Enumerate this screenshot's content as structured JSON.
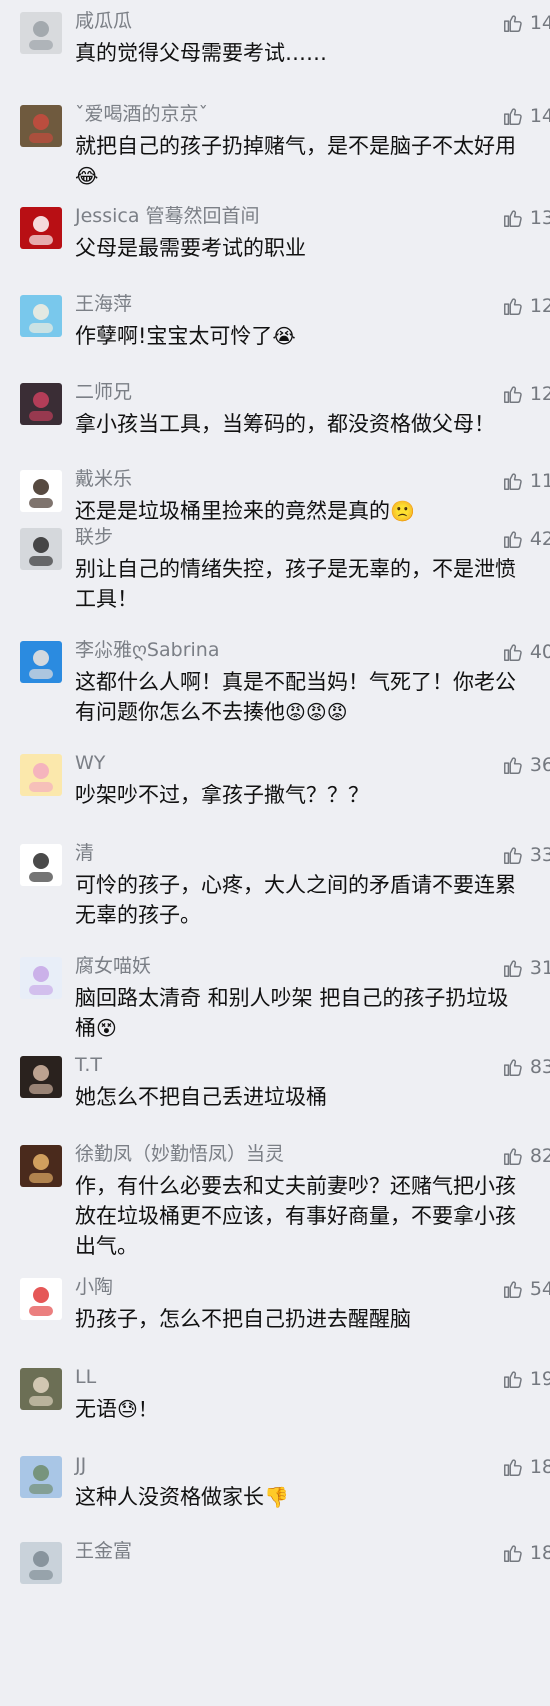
{
  "comments": [
    {
      "name": "咸瓜瓜",
      "likes": "14",
      "text": "真的觉得父母需要考试……",
      "emoji": "",
      "avatar": {
        "bg": "#d8dadd",
        "fg": "#9aa0a6"
      }
    },
    {
      "name": "ˇ爱喝酒的京京ˇ",
      "likes": "14",
      "text": "就把自己的孩子扔掉赌气，是不是脑子不太好用",
      "emoji": "😂",
      "avatar": {
        "bg": "#6f5a3e",
        "fg": "#c94b3e"
      }
    },
    {
      "name": "Jessica 管蓦然回首间",
      "likes": "13",
      "text": "父母是最需要考试的职业",
      "emoji": "",
      "avatar": {
        "bg": "#b80f14",
        "fg": "#ffffff"
      }
    },
    {
      "name": "王海萍",
      "likes": "12",
      "text": "作孽啊!宝宝太可怜了",
      "emoji": "😭",
      "avatar": {
        "bg": "#79c8ec",
        "fg": "#f6efe0"
      }
    },
    {
      "name": "二师兄",
      "likes": "12",
      "text": "拿小孩当工具，当筹码的，都没资格做父母！",
      "emoji": "",
      "avatar": {
        "bg": "#3a2d35",
        "fg": "#c9415e"
      }
    },
    {
      "name": "戴米乐",
      "likes": "11",
      "text": "还是是垃圾桶里捡来的竟然是真的",
      "emoji": "🙁",
      "avatar": {
        "bg": "#ffffff",
        "fg": "#3a2a20"
      }
    },
    {
      "name": "联步",
      "likes": "42",
      "text": "别让自己的情绪失控，孩子是无辜的，不是泄愤工具！",
      "emoji": "",
      "avatar": {
        "bg": "#d5d8dc",
        "fg": "#2b2b2b"
      }
    },
    {
      "name": "李尛雅ღSabrina",
      "likes": "40",
      "text": "这都什么人啊！真是不配当妈！气死了！你老公有问题你怎么不去揍他",
      "emoji": "😡😡😡",
      "avatar": {
        "bg": "#2b8be0",
        "fg": "#f1e6de"
      }
    },
    {
      "name": "WY",
      "likes": "36",
      "text": "吵架吵不过，拿孩子撒气？？？",
      "emoji": "",
      "avatar": {
        "bg": "#fbe8ac",
        "fg": "#f3aac0"
      }
    },
    {
      "name": "清",
      "likes": "33",
      "text": "可怜的孩子，心疼，大人之间的矛盾请不要连累无辜的孩子。",
      "emoji": "",
      "avatar": {
        "bg": "#ffffff",
        "fg": "#2a2a2a"
      }
    },
    {
      "name": "腐女喵妖",
      "likes": "31",
      "text": "脑回路太清奇 和别人吵架 把自己的孩子扔垃圾桶",
      "emoji": "😵",
      "avatar": {
        "bg": "#e8eef8",
        "fg": "#c6a6e6"
      }
    },
    {
      "name": "T.T",
      "likes": "83",
      "text": "她怎么不把自己丢进垃圾桶",
      "emoji": "",
      "avatar": {
        "bg": "#2a221e",
        "fg": "#d6b9a4"
      }
    },
    {
      "name": "徐勤凤（妙勤悟凤）当灵",
      "likes": "82",
      "text": "作，有什么必要去和丈夫前妻吵？还赌气把小孩放在垃圾桶更不应该，有事好商量，不要拿小孩出气。",
      "emoji": "",
      "avatar": {
        "bg": "#4a2a1c",
        "fg": "#e8b46a"
      }
    },
    {
      "name": "小陶",
      "likes": "54",
      "text": "扔孩子，怎么不把自己扔进去醒醒脑",
      "emoji": "",
      "avatar": {
        "bg": "#ffffff",
        "fg": "#e03a3a"
      }
    },
    {
      "name": "LL",
      "likes": "19",
      "text": "无语",
      "emoji": "😓！",
      "avatar": {
        "bg": "#6c6f55",
        "fg": "#e3d7c3"
      }
    },
    {
      "name": "JJ",
      "likes": "18",
      "text": "这种人没资格做家长",
      "emoji": "👎",
      "avatar": {
        "bg": "#a9c6e6",
        "fg": "#6e8b6a"
      }
    },
    {
      "name": "王金富",
      "likes": "18",
      "text": "",
      "emoji": "",
      "avatar": {
        "bg": "#c9d2da",
        "fg": "#7c8a92"
      }
    }
  ]
}
